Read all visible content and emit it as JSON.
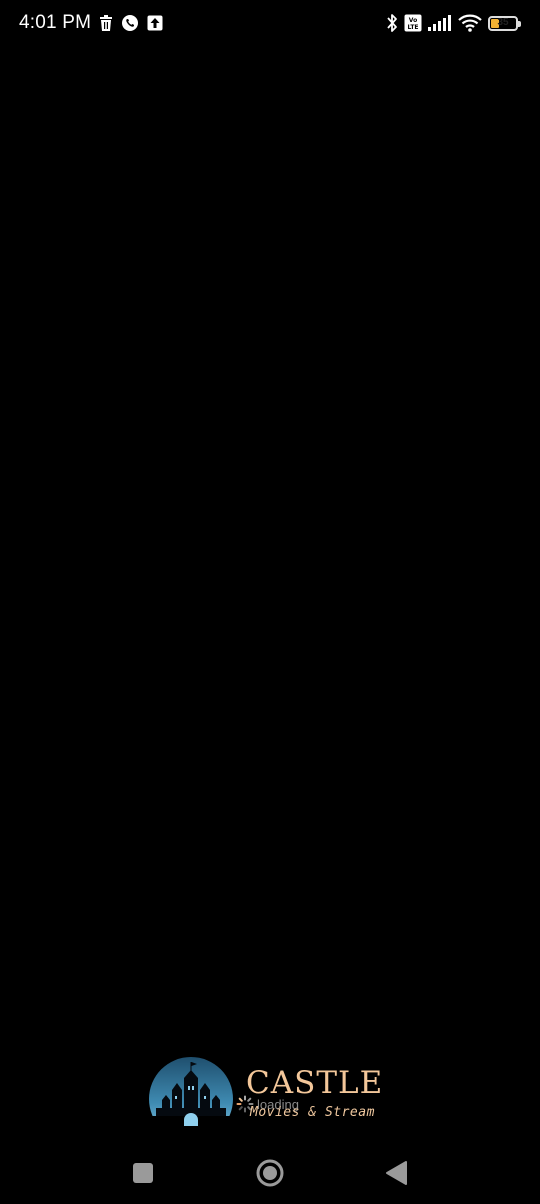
{
  "status_bar": {
    "time": "4:01 PM",
    "left_icons": [
      "trash-icon",
      "viber-icon",
      "upload-icon"
    ],
    "right_icons": [
      "bluetooth-icon",
      "volte-icon",
      "signal-icon",
      "wifi-icon",
      "battery-icon"
    ],
    "battery_level": "35",
    "battery_fraction": 0.35,
    "battery_color": "#f2b233"
  },
  "splash": {
    "brand_title": "CASTLE",
    "brand_subtitle": "Movies & Stream",
    "loading_text": "loading",
    "colors": {
      "title": "#f3c79a",
      "circle_top": "#2c6a8c",
      "circle_bottom": "#8fd0ee"
    }
  },
  "nav_bar": {
    "buttons": [
      "recents-square-icon",
      "home-circle-icon",
      "back-triangle-icon"
    ]
  }
}
